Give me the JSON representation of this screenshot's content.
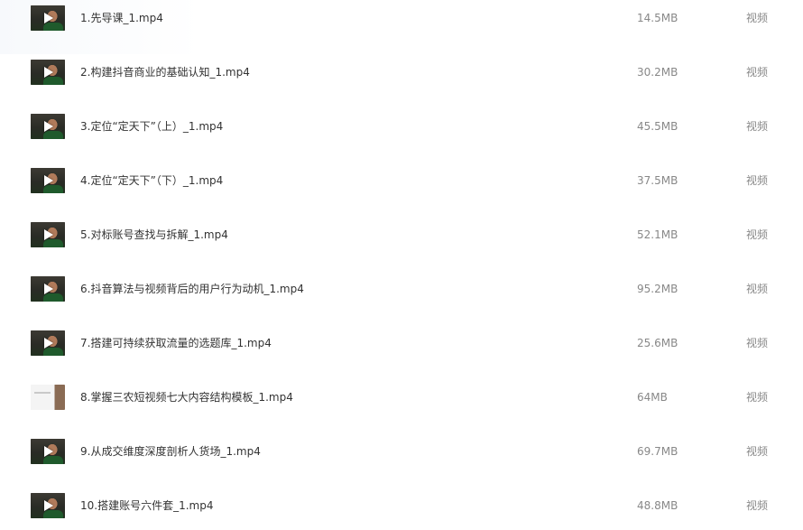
{
  "files": [
    {
      "name": "1.先导课_1.mp4",
      "size": "14.5MB",
      "type": "视频",
      "thumb_icon": "video-thumbnail"
    },
    {
      "name": "2.构建抖音商业的基础认知_1.mp4",
      "size": "30.2MB",
      "type": "视频",
      "thumb_icon": "video-thumbnail"
    },
    {
      "name": "3.定位“定天下”（上）_1.mp4",
      "size": "45.5MB",
      "type": "视频",
      "thumb_icon": "video-thumbnail"
    },
    {
      "name": "4.定位“定天下”（下）_1.mp4",
      "size": "37.5MB",
      "type": "视频",
      "thumb_icon": "video-thumbnail"
    },
    {
      "name": "5.对标账号查找与拆解_1.mp4",
      "size": "52.1MB",
      "type": "视频",
      "thumb_icon": "video-thumbnail"
    },
    {
      "name": "6.抖音算法与视频背后的用户行为动机_1.mp4",
      "size": "95.2MB",
      "type": "视频",
      "thumb_icon": "video-thumbnail"
    },
    {
      "name": "7.搭建可持续获取流量的选题库_1.mp4",
      "size": "25.6MB",
      "type": "视频",
      "thumb_icon": "video-thumbnail"
    },
    {
      "name": "8.掌握三农短视频七大内容结构模板_1.mp4",
      "size": "64MB",
      "type": "视频",
      "thumb_icon": "slide-thumbnail"
    },
    {
      "name": "9.从成交维度深度剖析人货场_1.mp4",
      "size": "69.7MB",
      "type": "视频",
      "thumb_icon": "video-thumbnail"
    },
    {
      "name": "10.搭建账号六件套_1.mp4",
      "size": "48.8MB",
      "type": "视频",
      "thumb_icon": "video-thumbnail"
    }
  ]
}
